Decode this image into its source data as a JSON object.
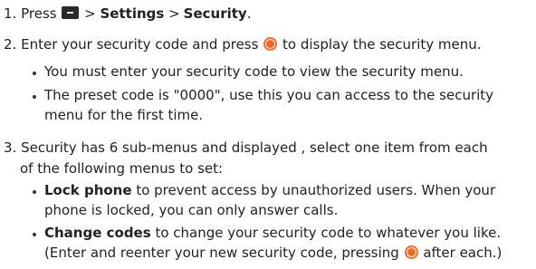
{
  "steps": [
    {
      "number": "1.",
      "pre": "Press",
      "menu_icon": "menu-key-icon",
      "sep1": ">",
      "settings": "Settings",
      "sep2": ">",
      "security": "Security",
      "end": "."
    },
    {
      "number": "2.",
      "pre": "Enter your security code and press",
      "ok_icon": "ok-key-icon",
      "post": "to display the security menu.",
      "bullets": [
        {
          "lines": [
            "You must enter your security code to view the security menu."
          ]
        },
        {
          "lines": [
            "The preset code is \"0000\", use this you can access to the security",
            "menu for the first time."
          ]
        }
      ]
    },
    {
      "number": "3.",
      "lines": [
        "Security has 6 sub-menus and displayed , select one item from each",
        "of the following menus to set:"
      ],
      "bullets": [
        {
          "term": "Lock phone",
          "rest": "to prevent access by unauthorized users. When your",
          "line2": "phone is locked, you can only answer calls."
        },
        {
          "term": "Change codes",
          "rest": "to change your security code to whatever you like.",
          "line2_pre": "(Enter and reenter your new security code, pressing",
          "line2_post": "after each.)"
        }
      ]
    }
  ],
  "colors": {
    "text": "#222222",
    "ok_key": "#f26522",
    "menu_key": "#2b2b2b"
  }
}
